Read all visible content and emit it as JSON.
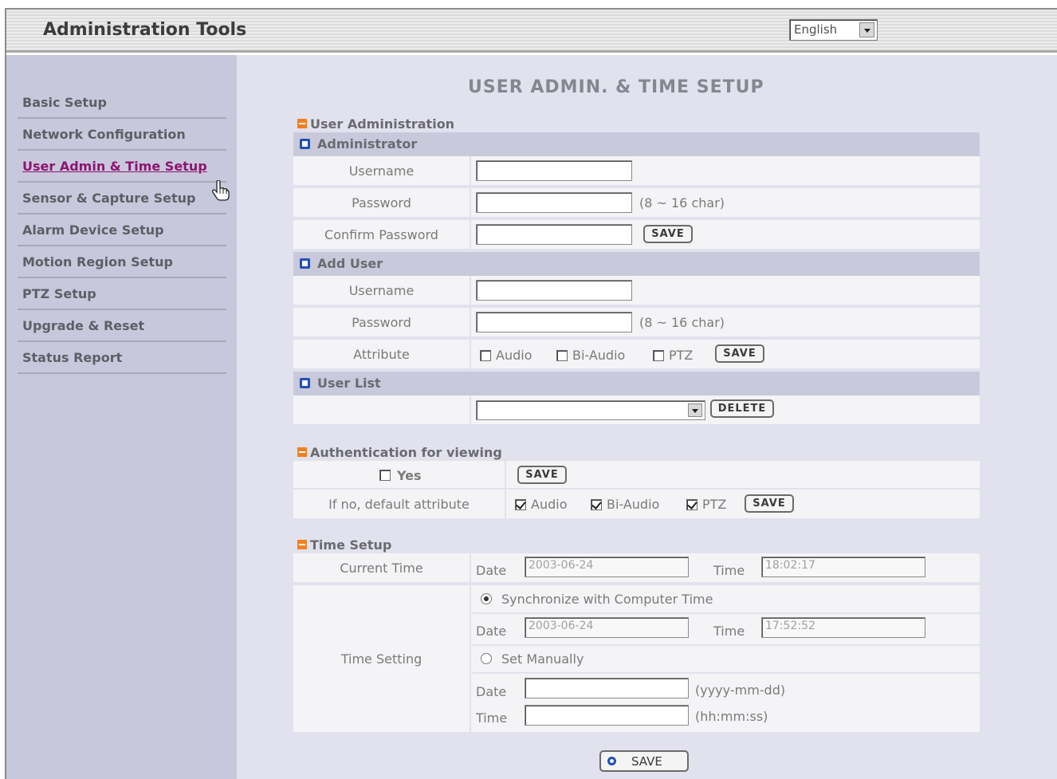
{
  "header": {
    "title": "Administration Tools",
    "language": "English"
  },
  "sidebar": {
    "items": [
      {
        "label": "Basic Setup"
      },
      {
        "label": "Network Configuration"
      },
      {
        "label": "User Admin & Time Setup",
        "active": true
      },
      {
        "label": "Sensor & Capture Setup"
      },
      {
        "label": "Alarm Device Setup"
      },
      {
        "label": "Motion Region Setup"
      },
      {
        "label": "PTZ Setup"
      },
      {
        "label": "Upgrade & Reset"
      },
      {
        "label": "Status Report"
      }
    ]
  },
  "main": {
    "title": "USER ADMIN. & TIME SETUP",
    "user_admin": {
      "title": "User Administration",
      "administrator": {
        "heading": "Administrator",
        "username_label": "Username",
        "password_label": "Password",
        "password_hint": "(8 ~ 16 char)",
        "confirm_label": "Confirm Password",
        "save": "SAVE"
      },
      "add_user": {
        "heading": "Add User",
        "username_label": "Username",
        "password_label": "Password",
        "password_hint": "(8 ~ 16 char)",
        "attribute_label": "Attribute",
        "audio": "Audio",
        "bi_audio": "Bi-Audio",
        "ptz": "PTZ",
        "save": "SAVE"
      },
      "user_list": {
        "heading": "User List",
        "delete": "DELETE"
      }
    },
    "auth": {
      "title": "Authentication for viewing",
      "yes": "Yes",
      "save": "SAVE",
      "default_label": "If no, default attribute",
      "audio": "Audio",
      "bi_audio": "Bi-Audio",
      "ptz": "PTZ",
      "save2": "SAVE"
    },
    "time": {
      "title": "Time Setup",
      "current_label": "Current Time",
      "date_label": "Date",
      "time_label": "Time",
      "current_date": "2003-06-24",
      "current_time": "18:02:17",
      "setting_label": "Time Setting",
      "sync_label": "Synchronize with Computer Time",
      "pc_date": "2003-06-24",
      "pc_time": "17:52:52",
      "manual_label": "Set Manually",
      "date_hint": "(yyyy-mm-dd)",
      "time_hint": "(hh:mm:ss)"
    },
    "save": "SAVE"
  },
  "colors": {
    "sidebar": "#c8c8dc",
    "main_bg": "#e2e2ee",
    "active_link": "#8c1570",
    "section_bullet": "#f08020",
    "subhead_icon": "#2050b8"
  }
}
